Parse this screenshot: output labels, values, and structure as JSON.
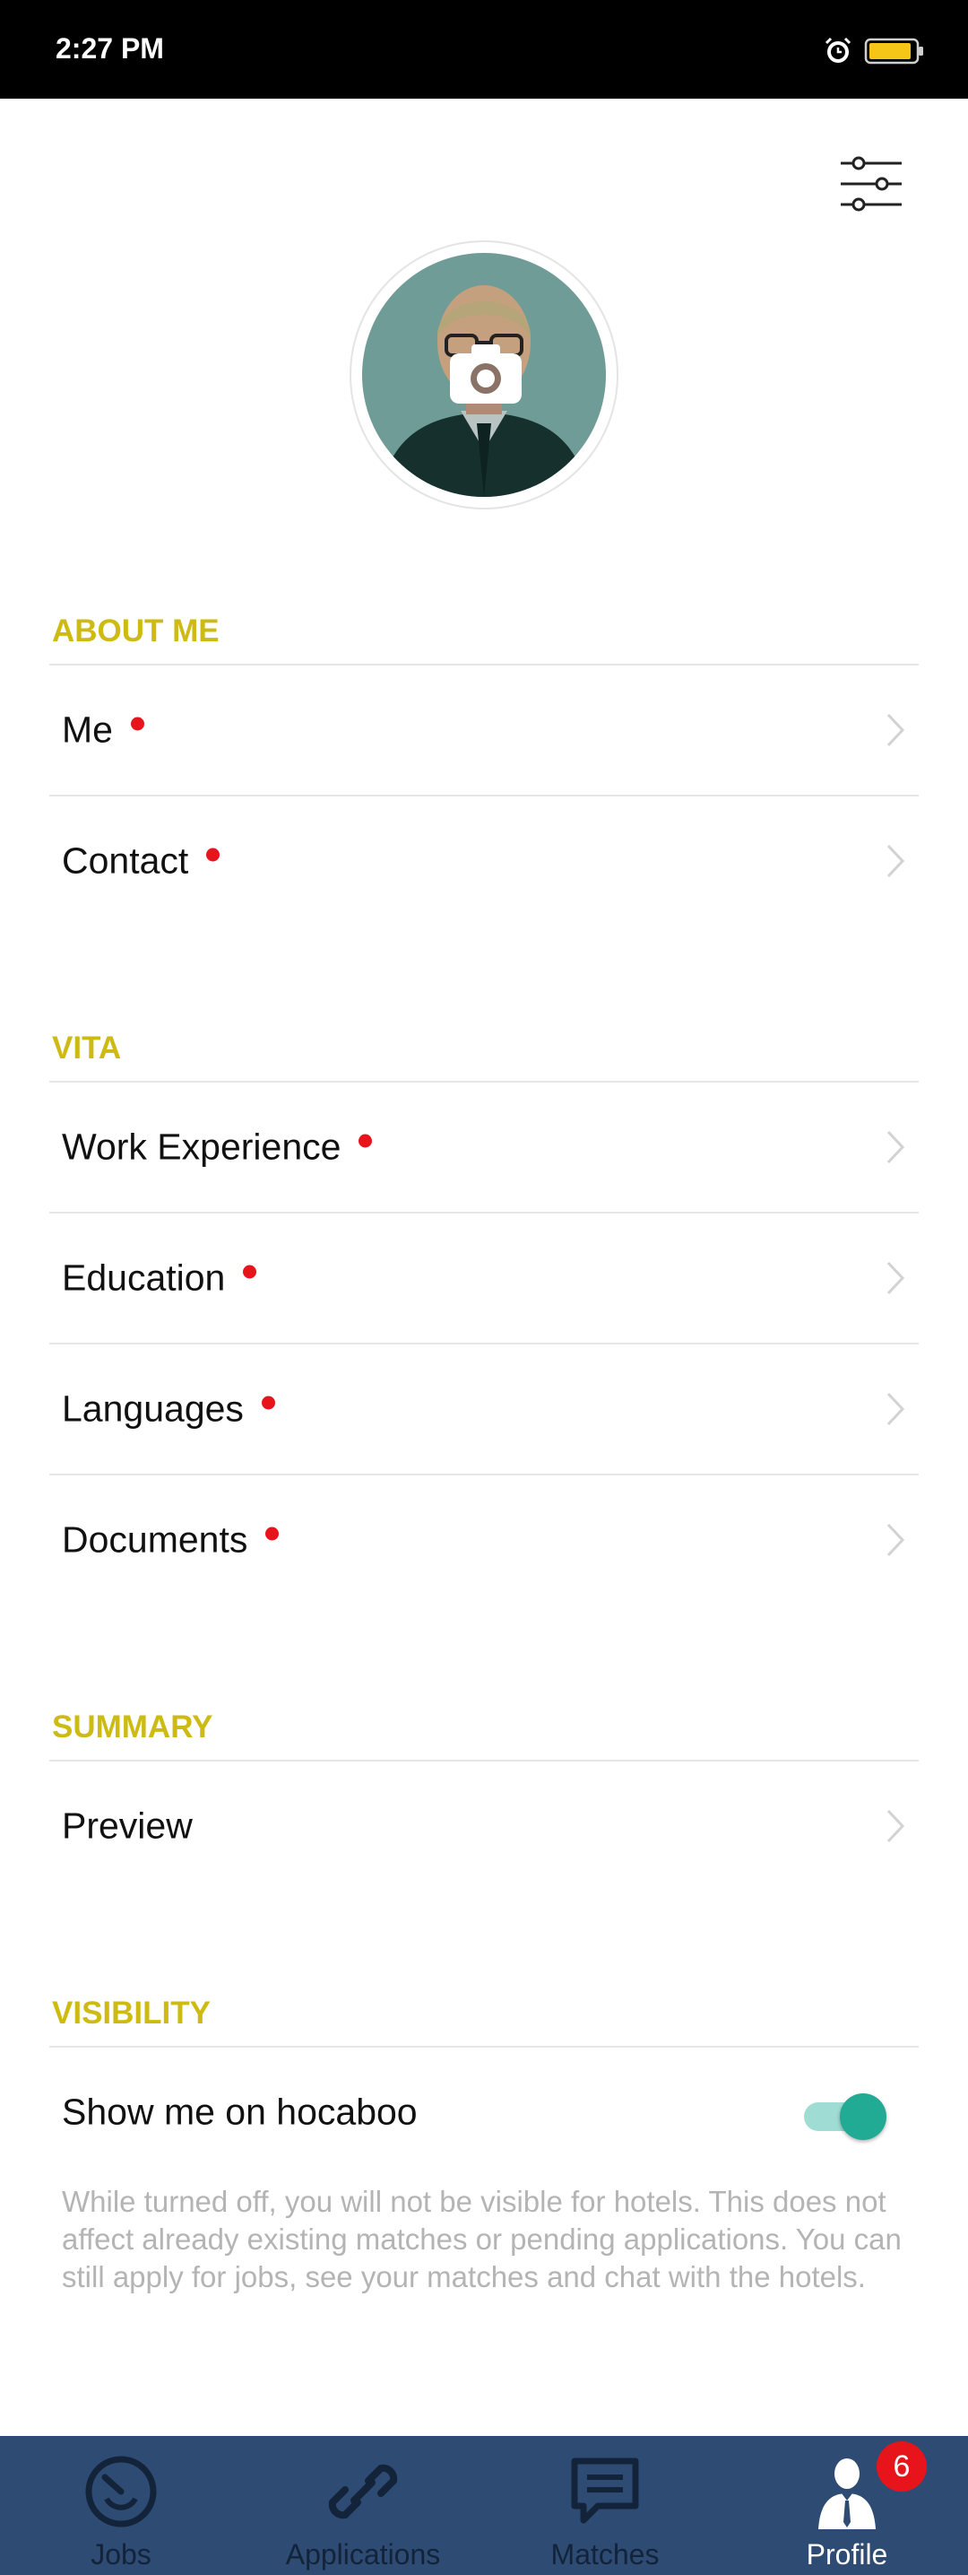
{
  "status_bar": {
    "time": "2:27 PM",
    "icons": [
      "alarm-icon",
      "battery-icon"
    ]
  },
  "header": {
    "filter_icon": "sliders-icon"
  },
  "profile": {
    "avatar_overlay_icon": "camera-icon"
  },
  "sections": {
    "about_me": {
      "title": "ABOUT ME",
      "items": [
        {
          "label": "Me",
          "incomplete": true
        },
        {
          "label": "Contact",
          "incomplete": true
        }
      ]
    },
    "vita": {
      "title": "VITA",
      "items": [
        {
          "label": "Work Experience",
          "incomplete": true
        },
        {
          "label": "Education",
          "incomplete": true
        },
        {
          "label": "Languages",
          "incomplete": true
        },
        {
          "label": "Documents",
          "incomplete": true
        }
      ]
    },
    "summary": {
      "title": "SUMMARY",
      "items": [
        {
          "label": "Preview",
          "incomplete": false
        }
      ]
    },
    "visibility": {
      "title": "VISIBILITY",
      "toggle_label": "Show me on hocaboo",
      "toggle_on": true,
      "note": "While turned off, you will not be visible for hotels. This does not affect already existing matches or pending applications. You can still apply for jobs, see your matches and chat with the hotels."
    }
  },
  "tabbar": {
    "tabs": [
      {
        "label": "Jobs",
        "icon": "jobs-icon",
        "active": false
      },
      {
        "label": "Applications",
        "icon": "link-icon",
        "active": false
      },
      {
        "label": "Matches",
        "icon": "chat-icon",
        "active": false
      },
      {
        "label": "Profile",
        "icon": "profile-icon",
        "active": true
      }
    ],
    "profile_badge": "6"
  },
  "colors": {
    "accent_yellow": "#cdbb14",
    "dot_red": "#e8141b",
    "tabbar_bg": "#2d4b73",
    "toggle_teal": "#21ab95"
  }
}
